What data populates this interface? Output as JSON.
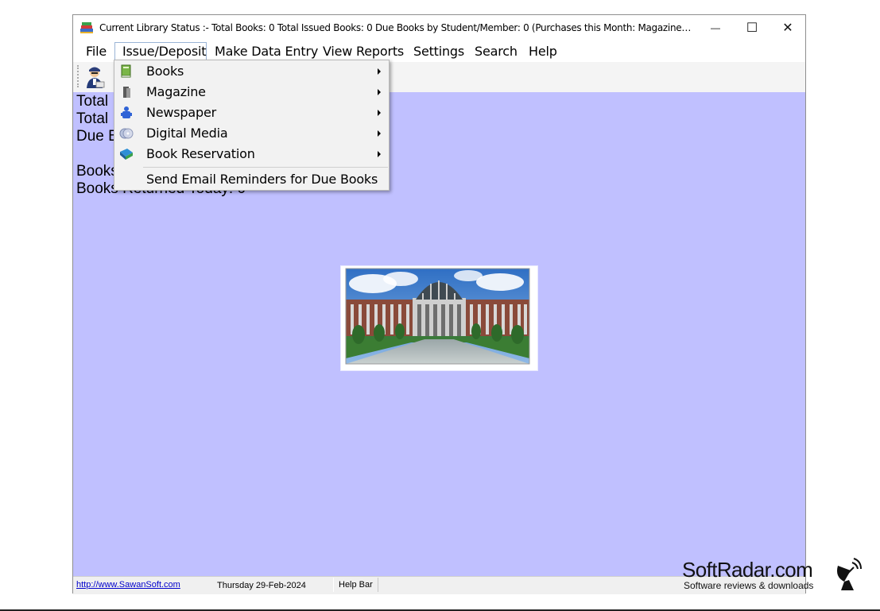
{
  "window": {
    "title": "Current Library Status :-   Total Books: 0  Total Issued Books: 0  Due Books by Student/Member: 0  (Purchases this Month: Magazines: 0  News...",
    "controls": {
      "minimize": "—",
      "maximize": "☐",
      "close": "✕"
    }
  },
  "menu": [
    "File",
    "Issue/Deposit",
    "Make Data Entry",
    "View Reports",
    "Settings",
    "Search",
    "Help"
  ],
  "dropdown": {
    "items": [
      {
        "label": "Books",
        "icon": "book-icon",
        "submenu": true
      },
      {
        "label": "Magazine",
        "icon": "magazine-icon",
        "submenu": true
      },
      {
        "label": "Newspaper",
        "icon": "newspaper-icon",
        "submenu": true
      },
      {
        "label": "Digital Media",
        "icon": "digital-media-icon",
        "submenu": true
      },
      {
        "label": "Book Reservation",
        "icon": "reservation-icon",
        "submenu": true
      },
      {
        "label": "Send Email Reminders for Due Books",
        "icon": "",
        "submenu": false
      }
    ]
  },
  "info": {
    "line1": "Total",
    "line2": "Total",
    "line3": "Due B",
    "line4": "Books",
    "line5": "Books Returned Today: 0"
  },
  "status": {
    "link": "http://www.SawanSoft.com",
    "date": "Thursday 29-Feb-2024",
    "help": "Help Bar"
  },
  "watermark": {
    "title": "SoftRadar.com",
    "subtitle": "Software reviews & downloads"
  },
  "colors": {
    "client_background": "#c0c0ff",
    "menu_background": "#f2f2f2",
    "link": "#0000cc"
  }
}
